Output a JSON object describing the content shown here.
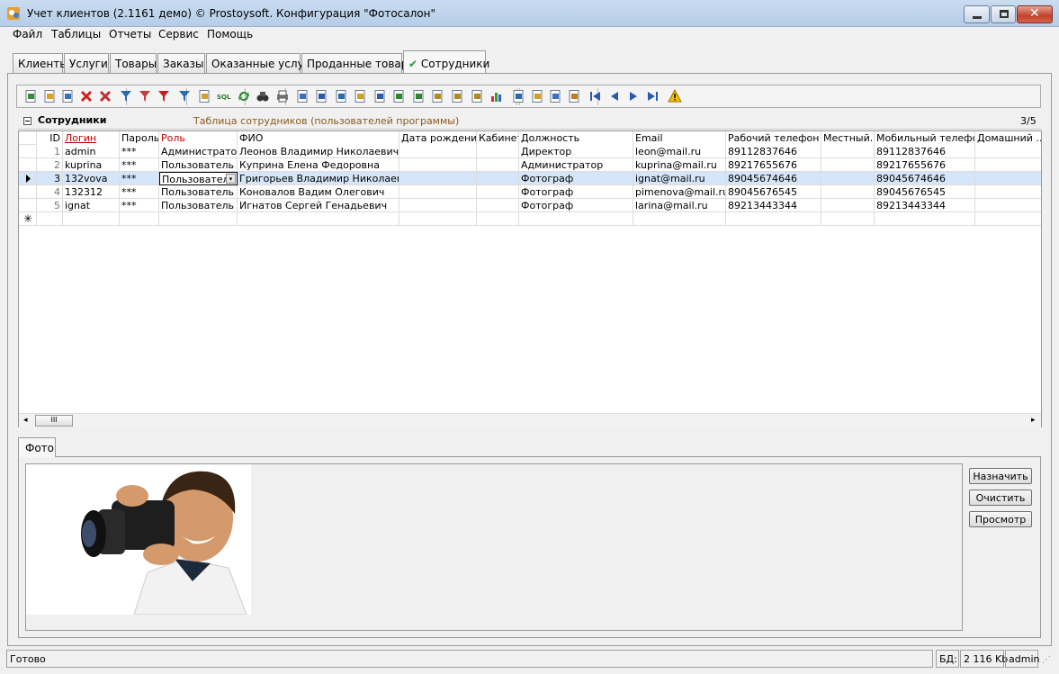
{
  "window": {
    "title": "Учет клиентов (2.1161 демо) © Prostoysoft. Конфигурация \"Фотосалон\"",
    "app_icon": "app-icon"
  },
  "menu": [
    "Файл",
    "Таблицы",
    "Отчеты",
    "Сервис",
    "Помощь"
  ],
  "tabs": [
    {
      "label": "Клиенты",
      "active": false
    },
    {
      "label": "Услуги",
      "active": false
    },
    {
      "label": "Товары",
      "active": false
    },
    {
      "label": "Заказы",
      "active": false
    },
    {
      "label": "Оказанные услуги",
      "active": false
    },
    {
      "label": "Проданные товары",
      "active": false
    },
    {
      "label": "Сотрудники",
      "active": true,
      "check": "✔"
    }
  ],
  "toolbar_icons": [
    "add-icon",
    "edit-icon",
    "copy-icon",
    "delete-icon",
    "delete-multiple-icon",
    "filter-icon",
    "filter-remove-icon",
    "filter-clear-icon",
    "funnel-icon",
    "group-icon",
    "sql-icon",
    "refresh-icon",
    "find-icon",
    "print-icon",
    "preview-icon",
    "export-word-icon",
    "export-word2-icon",
    "export-icon",
    "export-word3-icon",
    "export-excel-icon",
    "export-excel2-icon",
    "export-html-icon",
    "export-xml-icon",
    "export-csv-icon",
    "chart-icon",
    "sort-asc-icon",
    "sort-desc-icon",
    "columns-icon",
    "layout-icon",
    "first-icon",
    "prev-icon",
    "next-icon",
    "last-icon",
    "warning-icon"
  ],
  "grid": {
    "caption": "Сотрудники",
    "description": "Таблица сотрудников (пользователей программы)",
    "counter": "3/5",
    "columns": [
      "ID",
      "Логин",
      "Пароль",
      "Роль",
      "ФИО",
      "Дата рождения",
      "Кабинет",
      "Должность",
      "Email",
      "Рабочий телефон",
      "Местный...",
      "Мобильный телефон",
      "Домашний ..."
    ],
    "rows": [
      {
        "id": "1",
        "login": "admin",
        "password": "***",
        "role": "Администратор",
        "fio": "Леонов Владимир Николаевич",
        "birth": "",
        "cabinet": "",
        "position": "Директор",
        "email": "leon@mail.ru",
        "work_phone": "89112837646",
        "local": "",
        "mobile": "89112837646",
        "home": ""
      },
      {
        "id": "2",
        "login": "kuprina",
        "password": "***",
        "role": "Пользователь",
        "fio": "Куприна Елена Федоровна",
        "birth": "",
        "cabinet": "",
        "position": "Администратор",
        "email": "kuprina@mail.ru",
        "work_phone": "89217655676",
        "local": "",
        "mobile": "89217655676",
        "home": ""
      },
      {
        "id": "3",
        "login": "132vova",
        "password": "***",
        "role": "Пользовател",
        "fio": "Григорьев Владимир Николаевич",
        "birth": "",
        "cabinet": "",
        "position": "Фотограф",
        "email": "ignat@mail.ru",
        "work_phone": "89045674646",
        "local": "",
        "mobile": "89045674646",
        "home": ""
      },
      {
        "id": "4",
        "login": "132312",
        "password": "***",
        "role": "Пользователь",
        "fio": "Коновалов Вадим Олегович",
        "birth": "",
        "cabinet": "",
        "position": "Фотограф",
        "email": "pimenova@mail.ru",
        "work_phone": "89045676545",
        "local": "",
        "mobile": "89045676545",
        "home": ""
      },
      {
        "id": "5",
        "login": "ignat",
        "password": "***",
        "role": "Пользователь",
        "fio": "Игнатов Сергей Генадьевич",
        "birth": "",
        "cabinet": "",
        "position": "Фотограф",
        "email": "larina@mail.ru",
        "work_phone": "89213443344",
        "local": "",
        "mobile": "89213443344",
        "home": ""
      }
    ],
    "selected_row": 3,
    "scroll_thumb": "III"
  },
  "photo": {
    "tab_label": "Фото",
    "buttons": [
      "Назначить",
      "Очистить",
      "Просмотр"
    ]
  },
  "status": {
    "text": "Готово",
    "db_label": "БД:",
    "db_size": "2 116 Kb",
    "user": "admin"
  },
  "colors": {
    "required_header": "#c00000",
    "selected_row": "#d5e6fb",
    "check": "#2a9a2a"
  }
}
